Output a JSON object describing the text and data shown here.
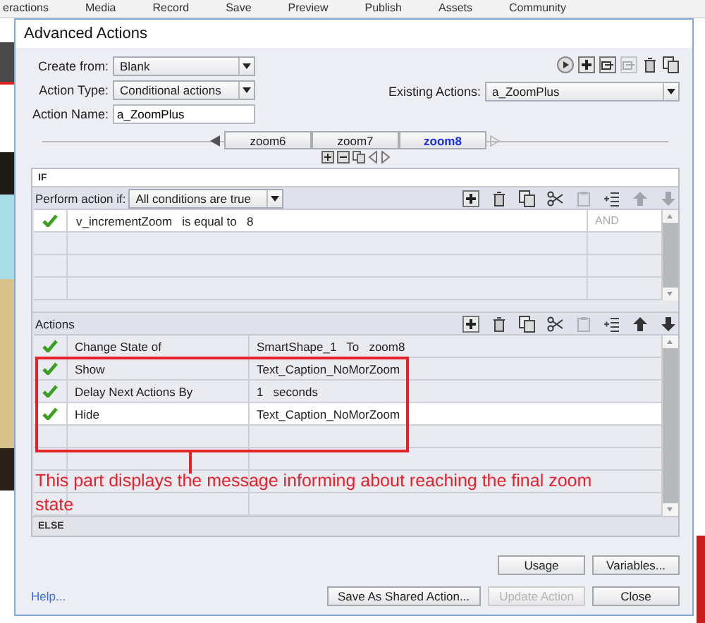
{
  "background_app": {
    "menu": [
      "eractions",
      "Media",
      "Record",
      "Save",
      "Preview",
      "Publish",
      "Assets",
      "Community"
    ]
  },
  "window": {
    "title": "Advanced Actions"
  },
  "form": {
    "create_from": {
      "label": "Create from:",
      "value": "Blank"
    },
    "action_type": {
      "label": "Action Type:",
      "value": "Conditional actions"
    },
    "action_name": {
      "label": "Action Name:",
      "value": "a_ZoomPlus"
    },
    "existing_actions": {
      "label": "Existing Actions:",
      "value": "a_ZoomPlus"
    }
  },
  "toolbar": [
    {
      "kind": "play",
      "disabled": false
    },
    {
      "kind": "add",
      "disabled": false
    },
    {
      "kind": "import",
      "disabled": false
    },
    {
      "kind": "export",
      "disabled": true
    },
    {
      "kind": "delete",
      "disabled": false
    },
    {
      "kind": "duplicate",
      "disabled": false
    }
  ],
  "decision_tabs": [
    {
      "label": "zoom6",
      "selected": false
    },
    {
      "label": "zoom7",
      "selected": false
    },
    {
      "label": "zoom8",
      "selected": true
    }
  ],
  "if_section": {
    "title": "IF",
    "perform_label": "Perform action if:",
    "perform_value": "All conditions are true",
    "tools": [
      {
        "kind": "add",
        "disabled": false
      },
      {
        "kind": "delete",
        "disabled": false
      },
      {
        "kind": "copy",
        "disabled": false
      },
      {
        "kind": "cut",
        "disabled": false
      },
      {
        "kind": "paste",
        "disabled": true
      },
      {
        "kind": "insert",
        "disabled": false
      },
      {
        "kind": "up",
        "disabled": true
      },
      {
        "kind": "down",
        "disabled": true
      }
    ],
    "conditions": [
      {
        "text": "v_incrementZoom   is equal to   8",
        "conjunction": "AND",
        "checked": true,
        "selected": true
      }
    ]
  },
  "actions_section": {
    "title": "Actions",
    "tools": [
      {
        "kind": "add",
        "disabled": false
      },
      {
        "kind": "delete",
        "disabled": false
      },
      {
        "kind": "copy",
        "disabled": false
      },
      {
        "kind": "cut",
        "disabled": false
      },
      {
        "kind": "paste",
        "disabled": true
      },
      {
        "kind": "insert",
        "disabled": false
      },
      {
        "kind": "up",
        "disabled": false
      },
      {
        "kind": "down",
        "disabled": false
      }
    ],
    "rows": [
      {
        "action": "Change State of",
        "target": "SmartShape_1   To   zoom8",
        "checked": true,
        "selected": false
      },
      {
        "action": "Show",
        "target": "Text_Caption_NoMorZoom",
        "checked": true,
        "selected": false
      },
      {
        "action": "Delay Next Actions By",
        "target": "1   seconds",
        "checked": true,
        "selected": false
      },
      {
        "action": "Hide",
        "target": "Text_Caption_NoMorZoom",
        "checked": true,
        "selected": true
      }
    ]
  },
  "annotation": {
    "text": "This part displays the message informing about reaching the final zoom state"
  },
  "else_section": {
    "title": "ELSE"
  },
  "buttons_top": [
    {
      "label": "Usage",
      "disabled": false
    },
    {
      "label": "Variables...",
      "disabled": false
    }
  ],
  "help_link": "Help...",
  "buttons_bottom": [
    {
      "label": "Save As Shared Action...",
      "disabled": false
    },
    {
      "label": "Update Action",
      "disabled": true
    },
    {
      "label": "Close",
      "disabled": false
    }
  ]
}
